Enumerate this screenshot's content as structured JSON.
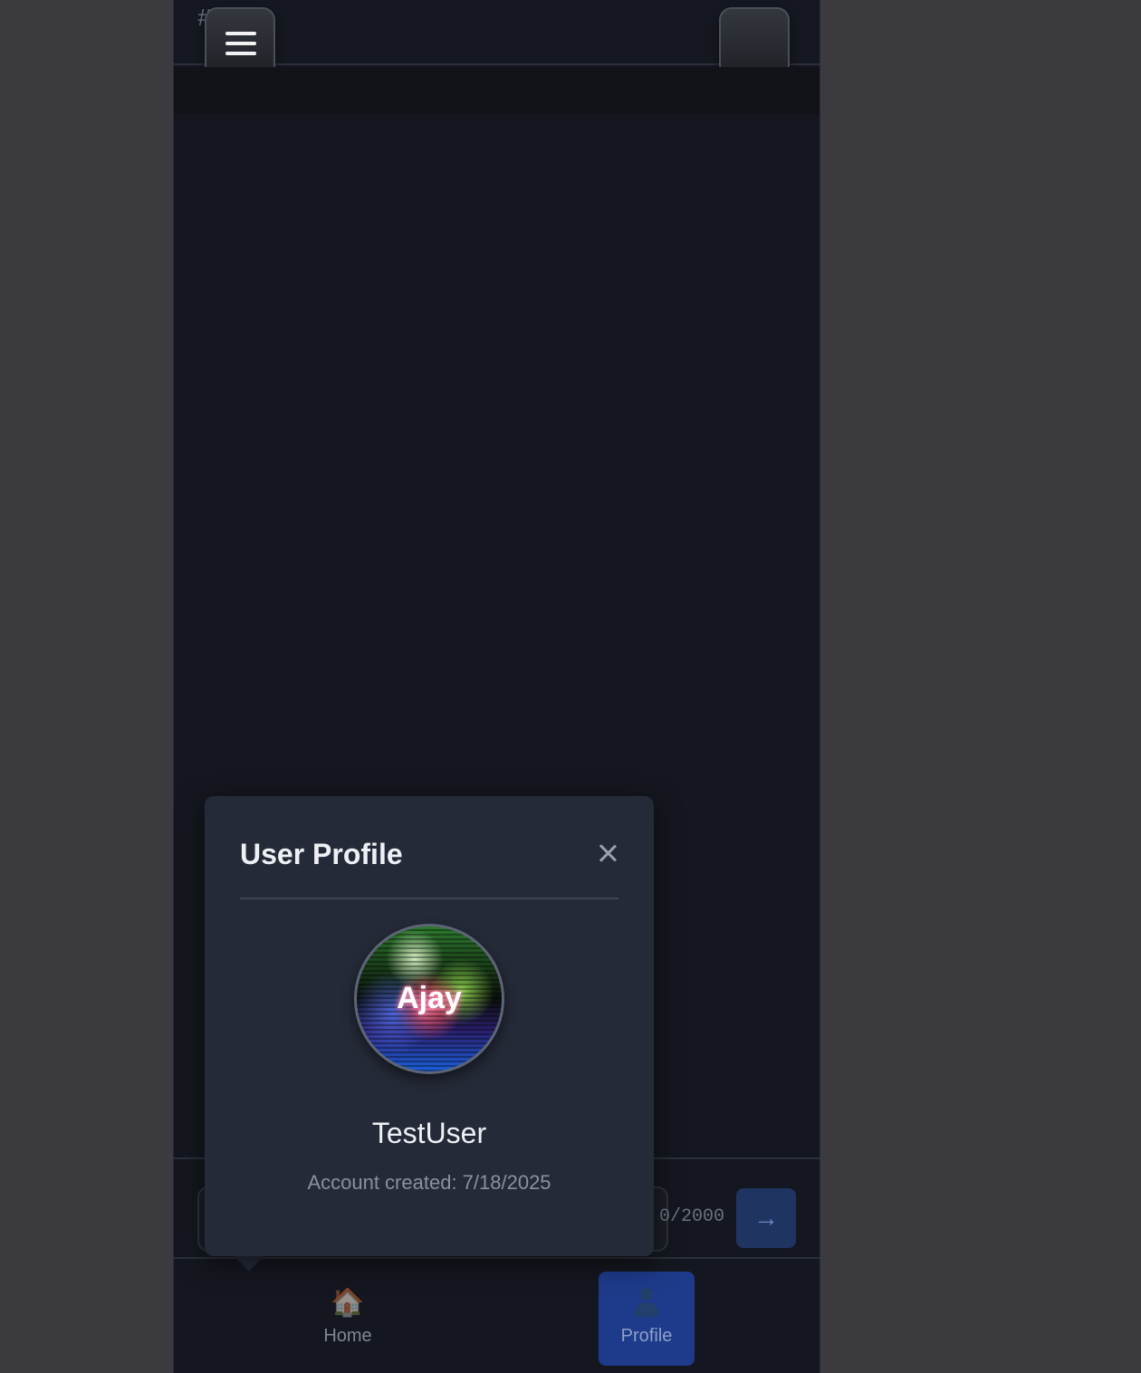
{
  "header": {
    "channel_prefix": "#",
    "menu_button": "hamburger-menu",
    "right_button": "blank"
  },
  "composer": {
    "char_count": "0/2000",
    "send_label": "→"
  },
  "bottom_nav": {
    "items": [
      {
        "label": "Home",
        "icon": "🏠"
      },
      {
        "label": "Profile",
        "icon": "person-icon",
        "active": true
      }
    ]
  },
  "profile_popover": {
    "title": "User Profile",
    "close": "×",
    "avatar_text": "Ajay",
    "username": "TestUser",
    "account_created": "Account created: 7/18/2025"
  },
  "colors": {
    "background": "#14171f",
    "popover": "#252a38",
    "accent": "#1e3a8a"
  }
}
